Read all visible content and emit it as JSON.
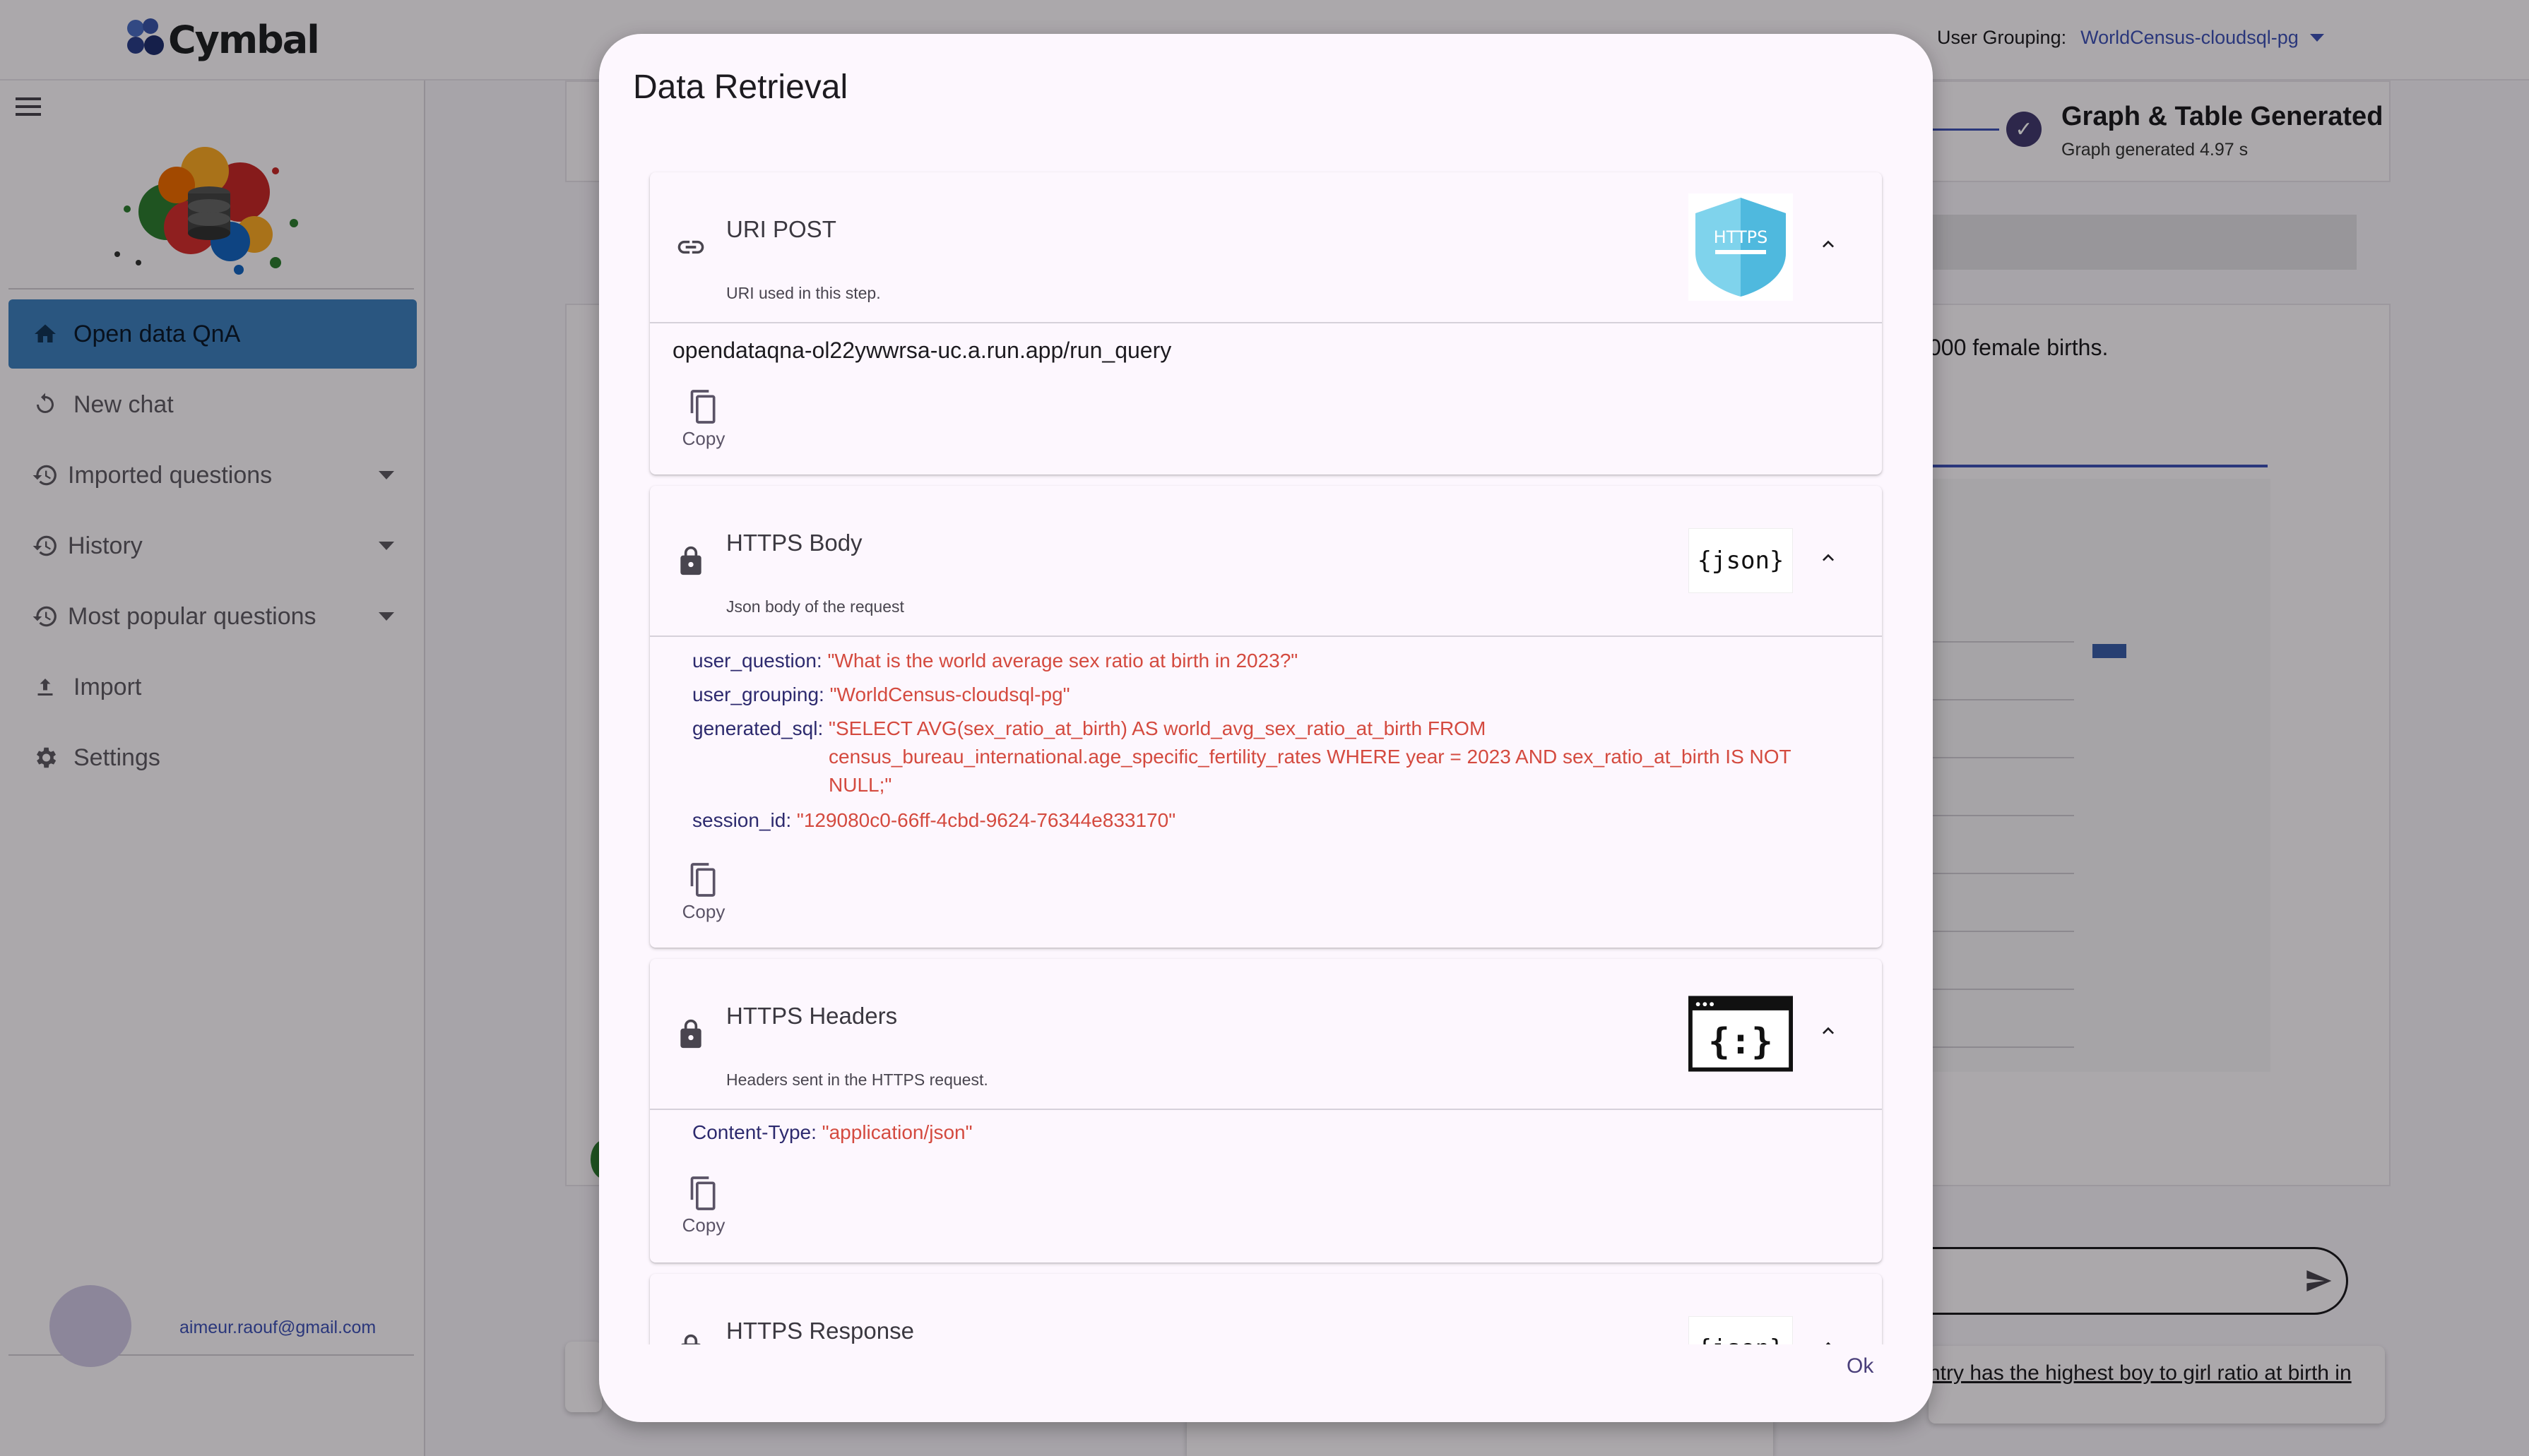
{
  "app": {
    "brand": "Cymbal",
    "user_grouping_label": "User Grouping:",
    "user_grouping_value": "WorldCensus-cloudsql-pg"
  },
  "sidebar": {
    "items": [
      {
        "label": "Open data QnA",
        "icon": "home-icon"
      },
      {
        "label": "New chat",
        "icon": "refresh-icon"
      },
      {
        "label": "Imported questions",
        "icon": "history-icon"
      },
      {
        "label": "History",
        "icon": "history-icon"
      },
      {
        "label": "Most popular questions",
        "icon": "history-icon"
      },
      {
        "label": "Import",
        "icon": "upload-icon"
      },
      {
        "label": "Settings",
        "icon": "gear-icon"
      }
    ],
    "email": "aimeur.raouf@gmail.com"
  },
  "background": {
    "status_title": "Graph & Table Generated",
    "status_sub": "Graph generated 4.97 s",
    "answer_fragment": "000 female births.",
    "suggestion_fragment": "ntry has the highest boy to girl ratio at birth in"
  },
  "dialog": {
    "title": "Data Retrieval",
    "ok_label": "Ok",
    "copy_label": "Copy",
    "panels": {
      "uri": {
        "title": "URI POST",
        "desc": "URI used in this step.",
        "badge": "HTTPS",
        "value": "opendataqna-ol22ywwrsa-uc.a.run.app/run_query"
      },
      "body": {
        "title": "HTTPS Body",
        "desc": "Json body of the request",
        "badge": "{json}",
        "user_question_key": "user_question",
        "user_question_val": "\"What is the world average sex ratio at birth in 2023?\"",
        "user_grouping_key": "user_grouping",
        "user_grouping_val": "\"WorldCensus-cloudsql-pg\"",
        "generated_sql_key": "generated_sql",
        "generated_sql_val": "\"SELECT AVG(sex_ratio_at_birth) AS world_avg_sex_ratio_at_birth FROM census_bureau_international.age_specific_fertility_rates WHERE year = 2023 AND sex_ratio_at_birth IS NOT NULL;\"",
        "session_id_key": "session_id",
        "session_id_val": "\"129080c0-66ff-4cbd-9624-76344e833170\""
      },
      "headers": {
        "title": "HTTPS Headers",
        "desc": "Headers sent in the HTTPS request.",
        "badge": "{:}",
        "content_type_key": "Content-Type",
        "content_type_val": "\"application/json\""
      },
      "response": {
        "title": "HTTPS Response",
        "badge": "{json}"
      }
    }
  },
  "colors": {
    "accent": "#3f51b5",
    "active_nav": "#3f7fbd",
    "json_value": "#d44a3f",
    "json_key": "#2d2a6e"
  }
}
